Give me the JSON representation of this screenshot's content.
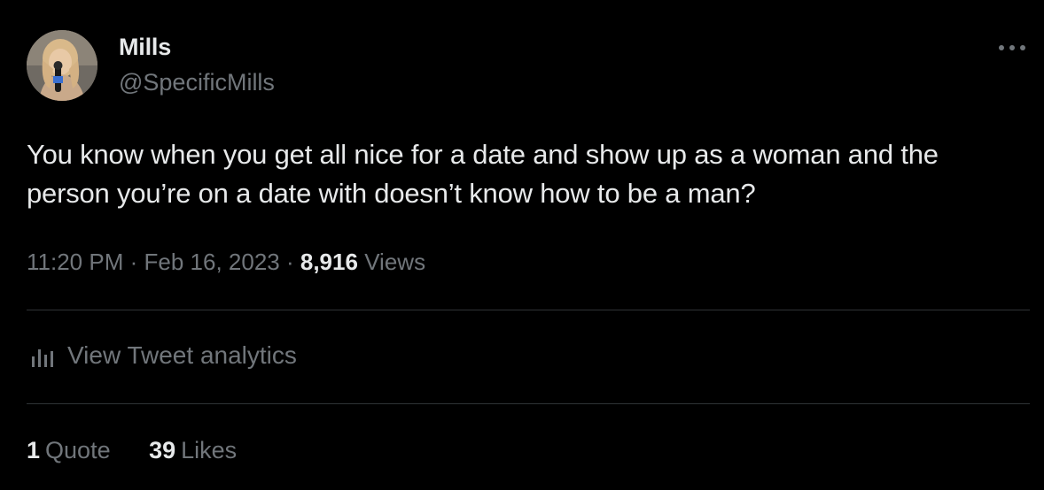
{
  "author": {
    "name": "Mills",
    "handle": "@SpecificMills"
  },
  "tweet": {
    "text": "You know when you get all nice for a date and show up as a woman and the person you’re on a date with doesn’t know how to be a man?",
    "time": "11:20 PM",
    "date": "Feb 16, 2023",
    "separator": "·",
    "views_count": "8,916",
    "views_label": "Views"
  },
  "analytics": {
    "label": "View Tweet analytics",
    "icon": "bar-chart-icon"
  },
  "stats": {
    "quotes_count": "1",
    "quotes_label": "Quote",
    "likes_count": "39",
    "likes_label": "Likes"
  },
  "colors": {
    "background": "#000000",
    "primary_text": "#e7e9ea",
    "secondary_text": "#71767b",
    "divider": "#2f3336"
  }
}
